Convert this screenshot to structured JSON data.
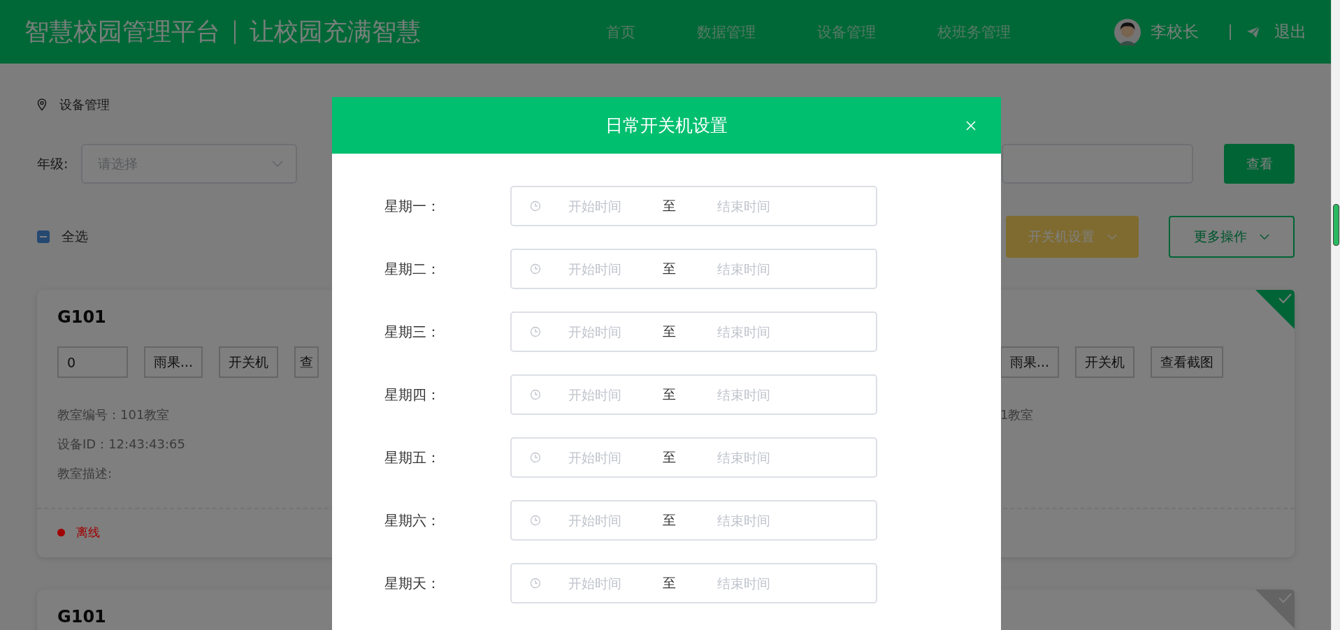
{
  "header": {
    "title": "智慧校园管理平台",
    "slogan": "让校园充满智慧",
    "nav": [
      {
        "label": "首页"
      },
      {
        "label": "数据管理"
      },
      {
        "label": "设备管理"
      },
      {
        "label": "校班务管理"
      }
    ],
    "user": "李校长",
    "logout": "退出"
  },
  "breadcrumb": "设备管理",
  "grade_filter": {
    "label": "年级:",
    "placeholder": "请选择"
  },
  "view_button": "查看",
  "select_all": {
    "label": "全选",
    "indeterminate": true
  },
  "power_button": "开关机设置",
  "more_button": "更多操作",
  "cards": [
    {
      "title": "G101",
      "selected": true,
      "code": "0",
      "buttons": [
        "雨果...",
        "开关机",
        "查"
      ],
      "info": [
        "教室编号：101教室",
        "设备ID：12:43:43:65",
        "教室描述:"
      ],
      "status": {
        "label": "离线",
        "color": "#a00000"
      },
      "right_buttons": [
        "雨果...",
        "开关机",
        "查看截图"
      ],
      "right_info": [
        "1教室"
      ]
    },
    {
      "title": "G101",
      "selected": false
    }
  ],
  "modal": {
    "title": "日常开关机设置",
    "rows": [
      {
        "day": "星期一：",
        "start_placeholder": "开始时间",
        "separator": "至",
        "end_placeholder": "结束时间"
      },
      {
        "day": "星期二：",
        "start_placeholder": "开始时间",
        "separator": "至",
        "end_placeholder": "结束时间"
      },
      {
        "day": "星期三：",
        "start_placeholder": "开始时间",
        "separator": "至",
        "end_placeholder": "结束时间"
      },
      {
        "day": "星期四：",
        "start_placeholder": "开始时间",
        "separator": "至",
        "end_placeholder": "结束时间"
      },
      {
        "day": "星期五：",
        "start_placeholder": "开始时间",
        "separator": "至",
        "end_placeholder": "结束时间"
      },
      {
        "day": "星期六：",
        "start_placeholder": "开始时间",
        "separator": "至",
        "end_placeholder": "结束时间"
      },
      {
        "day": "星期天：",
        "start_placeholder": "开始时间",
        "separator": "至",
        "end_placeholder": "结束时间"
      }
    ]
  }
}
